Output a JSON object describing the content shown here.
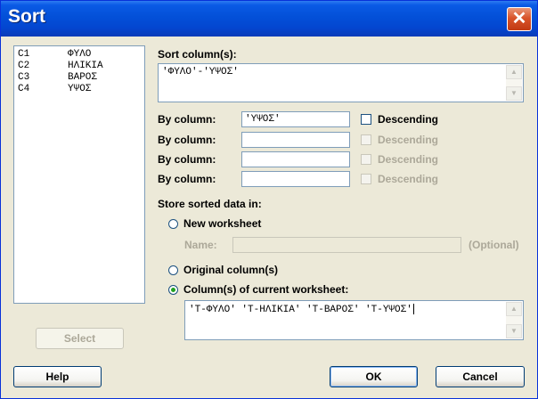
{
  "window": {
    "title": "Sort"
  },
  "columns": [
    {
      "id": "C1",
      "name": "ΦΥΛΟ"
    },
    {
      "id": "C2",
      "name": "ΗΛΙΚΙΑ"
    },
    {
      "id": "C3",
      "name": "ΒΑΡΟΣ"
    },
    {
      "id": "C4",
      "name": "ΥΨΟΣ"
    }
  ],
  "sort_columns": {
    "label": "Sort column(s):",
    "value": "'ΦΥΛΟ'-'ΥΨΟΣ'"
  },
  "by_columns": [
    {
      "label": "By column:",
      "value": "'ΥΨΟΣ'",
      "descending_label": "Descending"
    },
    {
      "label": "By column:",
      "value": "",
      "descending_label": "Descending"
    },
    {
      "label": "By column:",
      "value": "",
      "descending_label": "Descending"
    },
    {
      "label": "By column:",
      "value": "",
      "descending_label": "Descending"
    }
  ],
  "store": {
    "label": "Store sorted data in:",
    "new_worksheet": "New worksheet",
    "name_label": "Name:",
    "optional": "(Optional)",
    "original_columns": "Original column(s)",
    "current_worksheet": "Column(s) of current worksheet:",
    "current_value": "'Τ-ΦΥΛΟ' 'Τ-ΗΛΙΚΙΑ' 'Τ-ΒΑΡΟΣ' 'Τ-ΥΨΟΣ'"
  },
  "buttons": {
    "select": "Select",
    "help": "Help",
    "ok": "OK",
    "cancel": "Cancel"
  }
}
